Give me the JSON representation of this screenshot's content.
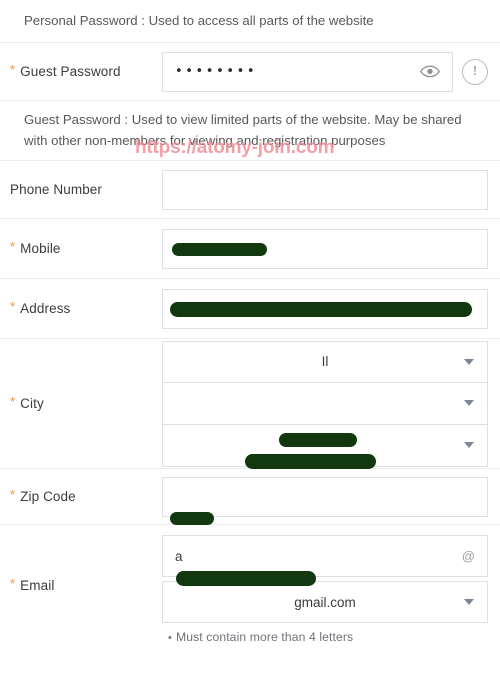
{
  "watermark": {
    "text": "https://atomy-join.com",
    "color": "#f08a96"
  },
  "colors": {
    "required_star": "#f09440",
    "border": "#dcdfe3",
    "divider": "#eceef0",
    "redaction": "#12380f",
    "caret": "#7b8797",
    "label": "#3c3c3c"
  },
  "notices": {
    "personal_password": "Personal Password : Used to access all parts of the website",
    "guest_password": "Guest Password : Used to view limited parts of the website. May be shared with other non-members for viewing and registration purposes"
  },
  "fields": {
    "guest_password": {
      "label": "Guest Password",
      "required": true,
      "required_marker": "*",
      "value": "••••••••",
      "masked_char_count": 8,
      "show_password_icon": "eye-icon",
      "alert_icon": "exclamation-circle-icon",
      "alert_icon_glyph": "!"
    },
    "phone_number": {
      "label": "Phone Number",
      "required": false,
      "value": "",
      "placeholder": ""
    },
    "mobile": {
      "label": "Mobile",
      "required": true,
      "required_marker": "*",
      "value": "",
      "redacted": true
    },
    "address": {
      "label": "Address",
      "required": true,
      "required_marker": "*",
      "value": "",
      "redacted": true
    },
    "city": {
      "label": "City",
      "required": true,
      "required_marker": "*",
      "selects": [
        {
          "name": "state-select",
          "value": "Il",
          "redacted": false
        },
        {
          "name": "county-select",
          "value": "",
          "redacted": true
        },
        {
          "name": "town-select",
          "value": "",
          "redacted": true
        }
      ]
    },
    "zip_code": {
      "label": "Zip Code",
      "required": true,
      "required_marker": "*",
      "value": "",
      "redacted": true
    },
    "email": {
      "label": "Email",
      "required": true,
      "required_marker": "*",
      "local_part_value": "a",
      "local_part_redacted": true,
      "at_symbol": "@",
      "domain_value": "gmail.com",
      "hint_bullet": "•",
      "hint": "Must contain more than 4 letters"
    }
  }
}
